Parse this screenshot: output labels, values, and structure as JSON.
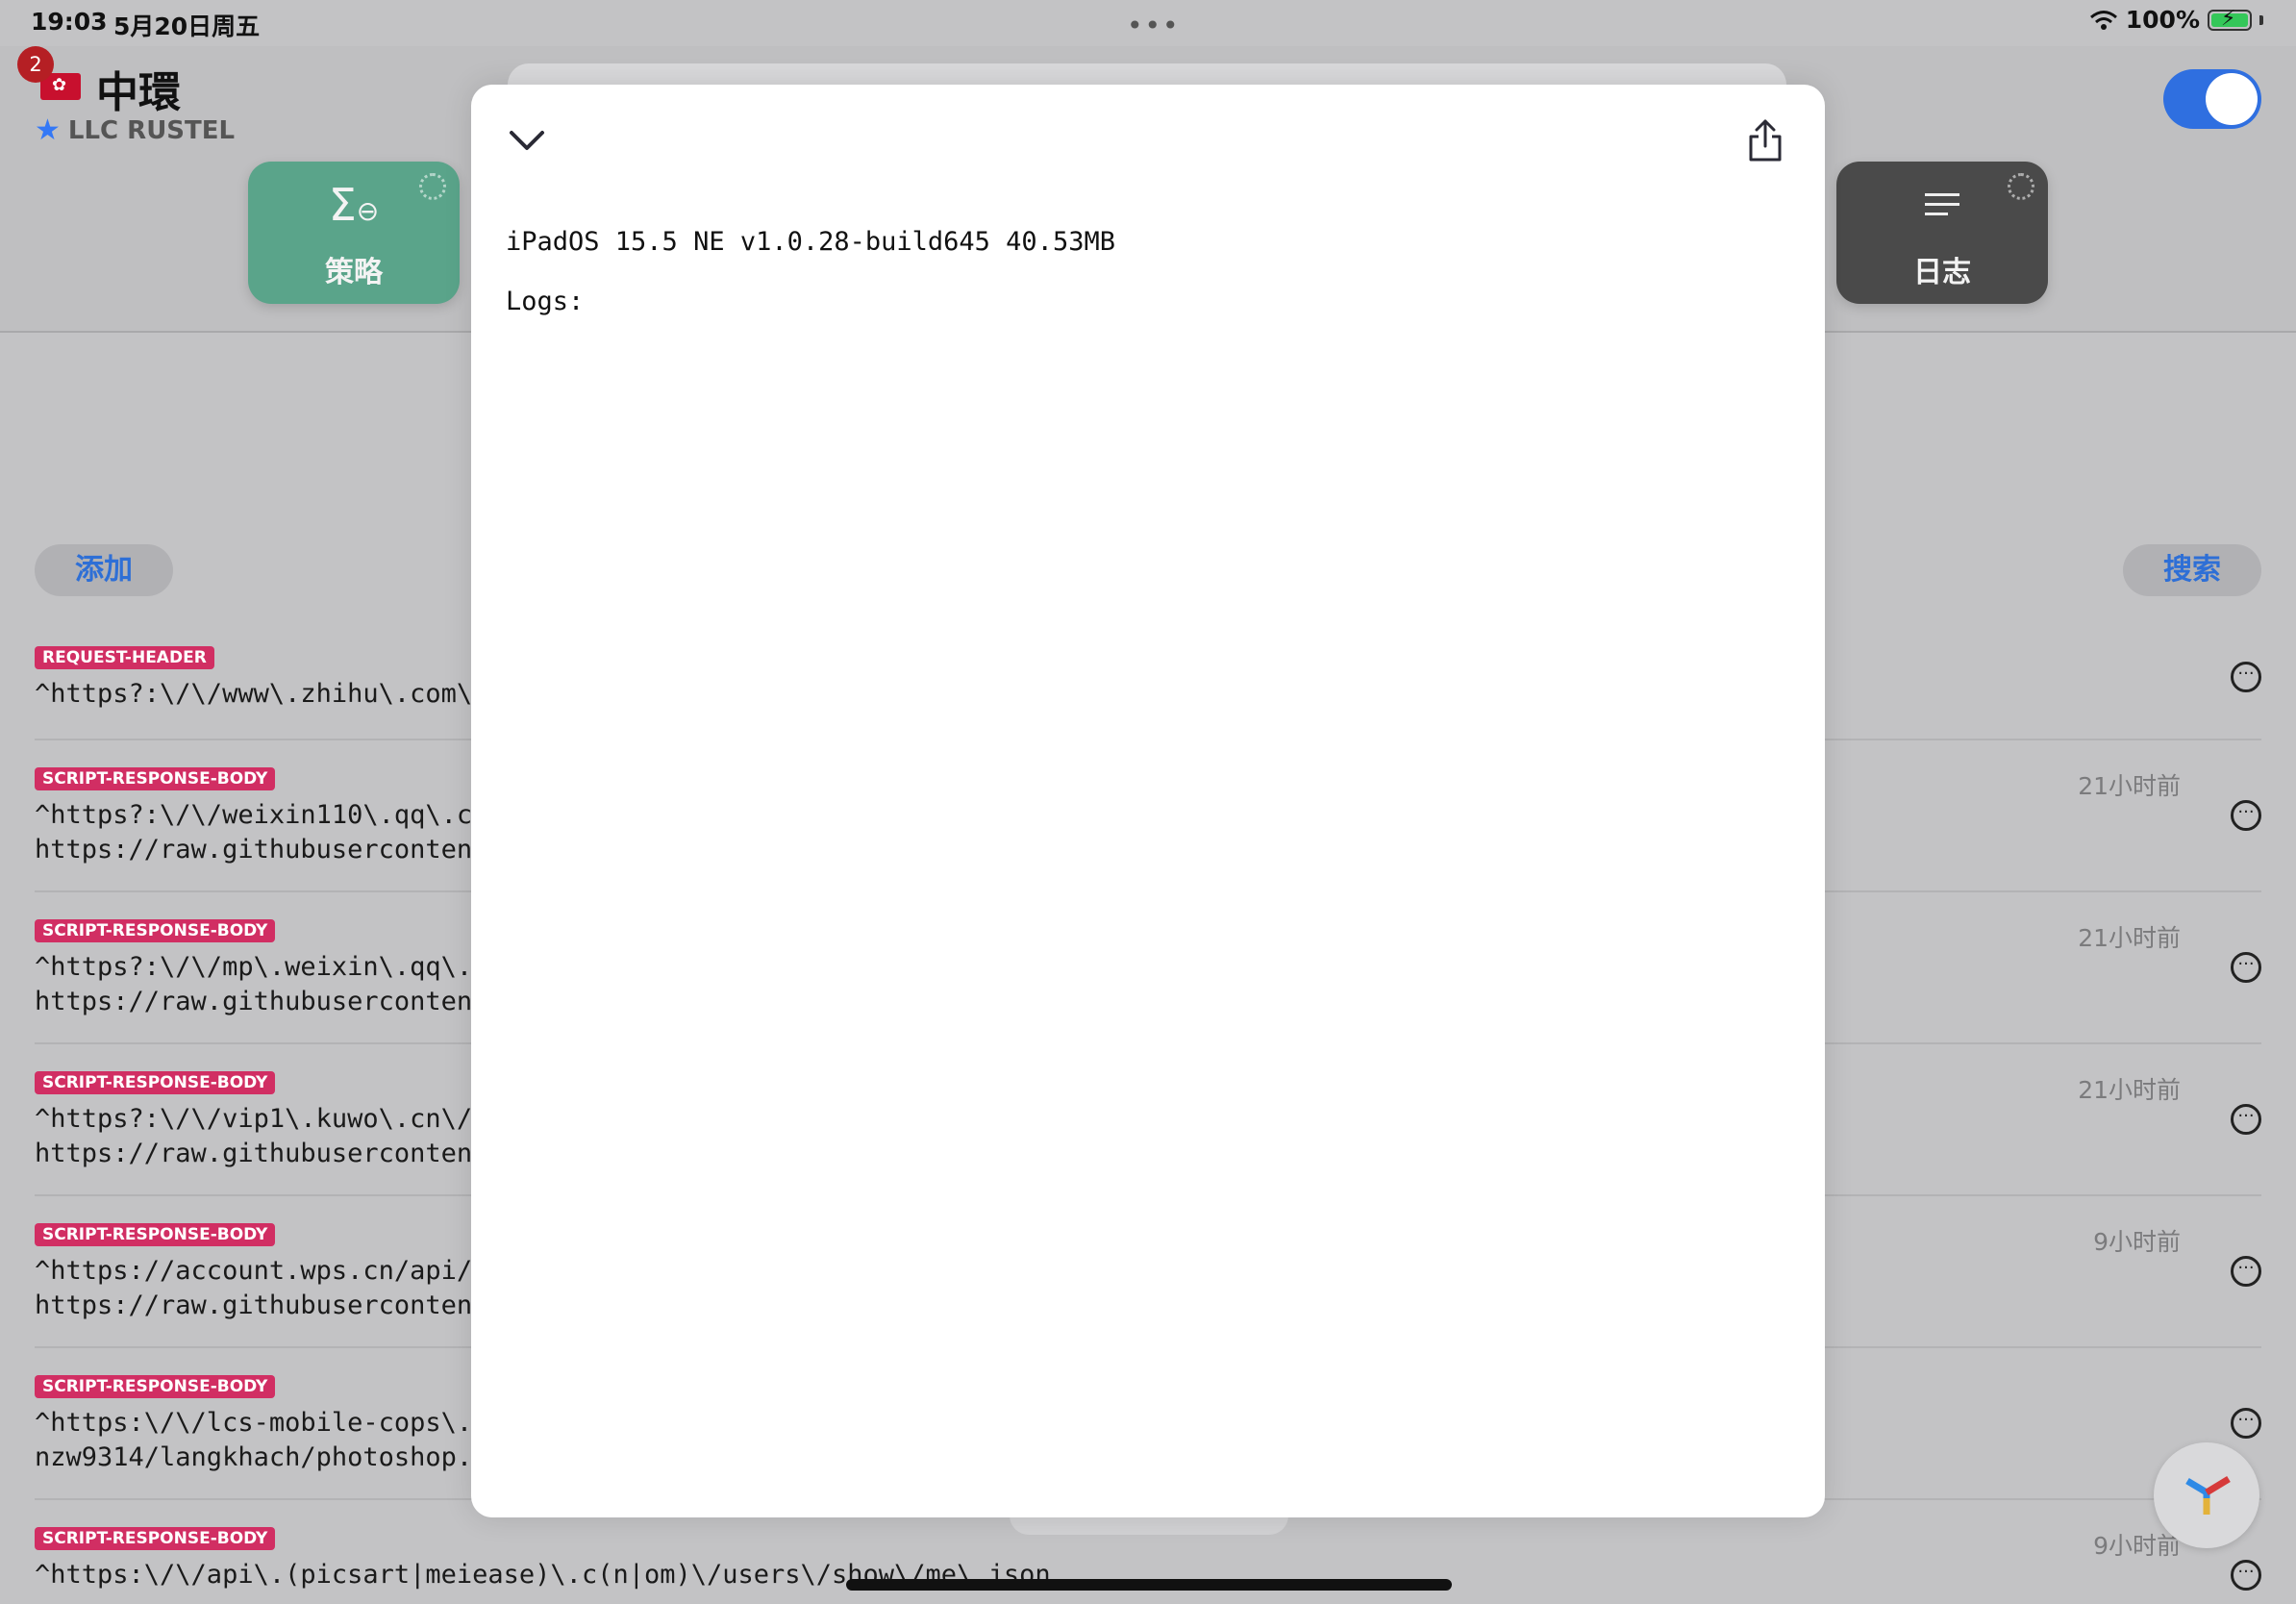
{
  "status_bar": {
    "time": "19:03",
    "date": "5月20日周五",
    "battery": "100%"
  },
  "header": {
    "badge_count": "2",
    "title": "中環",
    "subtitle": "LLC RUSTEL",
    "accent": "#2f6fe0"
  },
  "tiles": {
    "strategy": {
      "label": "策略",
      "icon": "sigma-icon",
      "color": "#5aa48a"
    },
    "log": {
      "label": "日志",
      "icon": "lines-icon",
      "color": "#4a4a4a"
    }
  },
  "actions": {
    "add_label": "添加",
    "search_label": "搜索"
  },
  "rules": [
    {
      "type": "REQUEST-HEADER",
      "line1": "^https?:\\/\\/www\\.zhihu\\.com\\.",
      "line2": "",
      "time": ""
    },
    {
      "type": "SCRIPT-RESPONSE-BODY",
      "line1": "^https?:\\/\\/weixin110\\.qq\\.c",
      "line2": "https://raw.githubuserconten",
      "time": "21小时前"
    },
    {
      "type": "SCRIPT-RESPONSE-BODY",
      "line1": "^https?:\\/\\/mp\\.weixin\\.qq\\.",
      "line2": "https://raw.githubuserconten",
      "time": "21小时前"
    },
    {
      "type": "SCRIPT-RESPONSE-BODY",
      "line1": "^https?:\\/\\/vip1\\.kuwo\\.cn\\/",
      "line2": "https://raw.githubuserconten",
      "time": "21小时前"
    },
    {
      "type": "SCRIPT-RESPONSE-BODY",
      "line1": "^https://account.wps.cn/api/u",
      "line2": "https://raw.githubuserconten",
      "time": "9小时前"
    },
    {
      "type": "SCRIPT-RESPONSE-BODY",
      "line1": "^https:\\/\\/lcs-mobile-cops\\.a",
      "line2": "nzw9314/langkhach/photoshop.j",
      "time": ""
    },
    {
      "type": "SCRIPT-RESPONSE-BODY",
      "line1": "^https:\\/\\/api\\.(picsart|meiease)\\.c(n|om)\\/users\\/show\\/me\\.json",
      "line2": "",
      "time": "9小时前"
    }
  ],
  "modal": {
    "info": "iPadOS 15.5 NE v1.0.28-build645 40.53MB",
    "logs_label": "Logs:"
  }
}
